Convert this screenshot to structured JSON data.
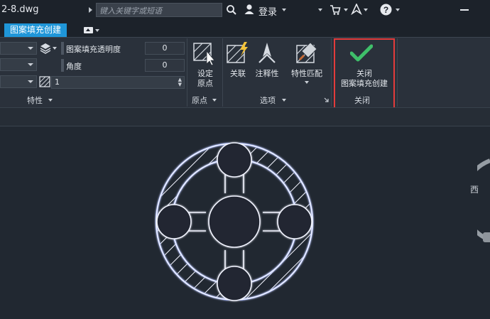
{
  "titlebar": {
    "doc_title": "2-8.dwg",
    "search_placeholder": "键入关键字或短语",
    "login_label": "登录"
  },
  "tabs": {
    "active_tab": "图案填充创建"
  },
  "properties_panel": {
    "transparency_label": "图案填充透明度",
    "transparency_value": "0",
    "angle_label": "角度",
    "angle_value": "0",
    "scale_value": "1",
    "panel_title": "特性"
  },
  "origin_panel": {
    "set_origin_line1": "设定",
    "set_origin_line2": "原点",
    "panel_title": "原点"
  },
  "options_panel": {
    "associative_label": "关联",
    "annotative_label": "注释性",
    "match_props_label": "特性匹配",
    "panel_title": "选项"
  },
  "close_panel": {
    "close_line1": "关闭",
    "close_line2": "图案填充创建",
    "panel_title": "关闭"
  },
  "viewcube": {
    "west_label": "西"
  },
  "colors": {
    "accent_tab": "#1f96d8",
    "highlight_border": "#e33b3b",
    "check_green": "#3fbf6a",
    "drawing_stroke": "#f2f4ff",
    "drawing_glow": "#5a7bff"
  }
}
